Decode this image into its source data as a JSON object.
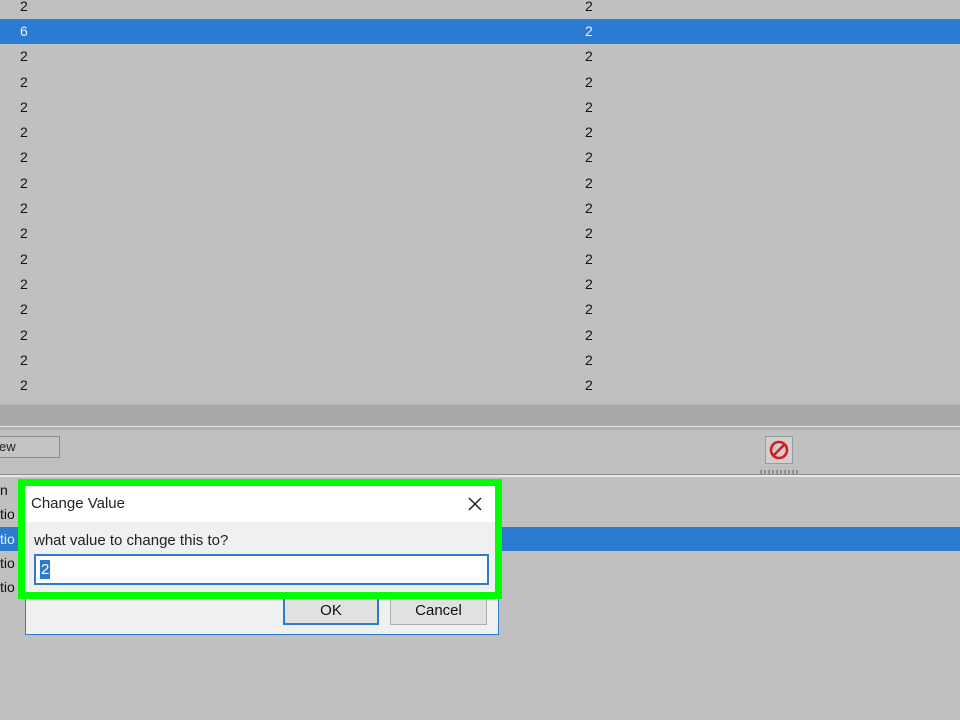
{
  "results": {
    "rows": [
      {
        "value1": "2",
        "value2": "2",
        "selected": false
      },
      {
        "value1": "6",
        "value2": "2",
        "selected": true
      },
      {
        "value1": "2",
        "value2": "2",
        "selected": false
      },
      {
        "value1": "2",
        "value2": "2",
        "selected": false
      },
      {
        "value1": "2",
        "value2": "2",
        "selected": false
      },
      {
        "value1": "2",
        "value2": "2",
        "selected": false
      },
      {
        "value1": "2",
        "value2": "2",
        "selected": false
      },
      {
        "value1": "2",
        "value2": "2",
        "selected": false
      },
      {
        "value1": "2",
        "value2": "2",
        "selected": false
      },
      {
        "value1": "2",
        "value2": "2",
        "selected": false
      },
      {
        "value1": "2",
        "value2": "2",
        "selected": false
      },
      {
        "value1": "2",
        "value2": "2",
        "selected": false
      },
      {
        "value1": "2",
        "value2": "2",
        "selected": false
      },
      {
        "value1": "2",
        "value2": "2",
        "selected": false
      },
      {
        "value1": "2",
        "value2": "2",
        "selected": false
      },
      {
        "value1": "2",
        "value2": "2",
        "selected": false
      }
    ]
  },
  "toolbar": {
    "new_label": "ew",
    "stop_icon": "no-entry-icon"
  },
  "lower_list": {
    "rows": [
      {
        "text": "n",
        "selected": false
      },
      {
        "text": "tio",
        "selected": false
      },
      {
        "text": "tio",
        "selected": true
      },
      {
        "text": "tio",
        "selected": false
      },
      {
        "text": "tio",
        "selected": false
      }
    ]
  },
  "dialog": {
    "title": "Change Value",
    "prompt": "what value to change this to?",
    "value": "2",
    "ok_label": "OK",
    "cancel_label": "Cancel",
    "highlight_color": "#00ff00",
    "selection_color": "#2b7bd0"
  }
}
